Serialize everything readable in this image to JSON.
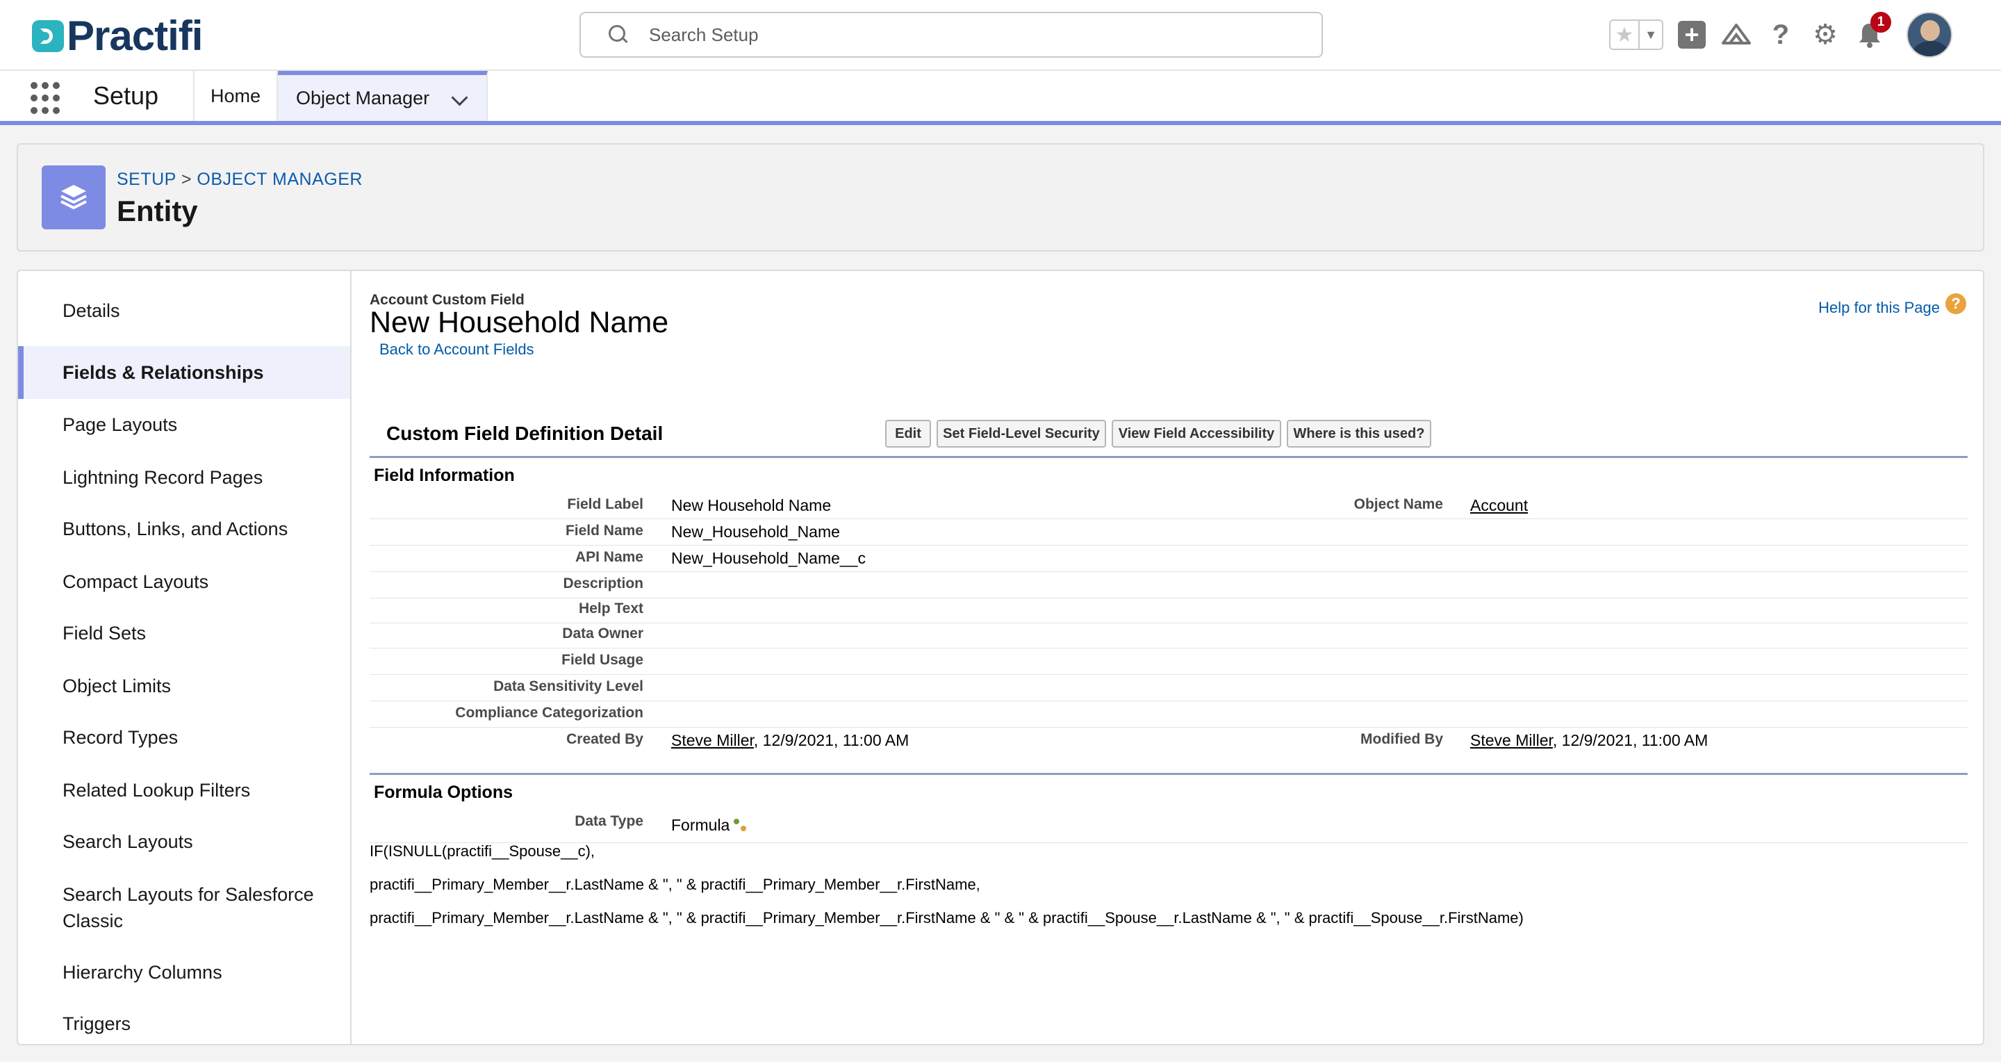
{
  "header": {
    "logo_text": "Practifi",
    "search_placeholder": "Search Setup",
    "notification_count": "1"
  },
  "nav": {
    "app_name": "Setup",
    "tabs": [
      {
        "label": "Home"
      },
      {
        "label": "Object Manager"
      }
    ]
  },
  "title_card": {
    "breadcrumb_setup": "SETUP",
    "breadcrumb_sep": ">",
    "breadcrumb_object_manager": "OBJECT MANAGER",
    "title": "Entity"
  },
  "sidebar": {
    "items": [
      {
        "label": "Details"
      },
      {
        "label": "Fields & Relationships"
      },
      {
        "label": "Page Layouts"
      },
      {
        "label": "Lightning Record Pages"
      },
      {
        "label": "Buttons, Links, and Actions"
      },
      {
        "label": "Compact Layouts"
      },
      {
        "label": "Field Sets"
      },
      {
        "label": "Object Limits"
      },
      {
        "label": "Record Types"
      },
      {
        "label": "Related Lookup Filters"
      },
      {
        "label": "Search Layouts"
      },
      {
        "label": "Search Layouts for Salesforce Classic"
      },
      {
        "label": "Hierarchy Columns"
      },
      {
        "label": "Triggers"
      }
    ]
  },
  "detail": {
    "sub_title": "Account Custom Field",
    "title": "New Household Name",
    "back_link": "Back to Account Fields",
    "help_link": "Help for this Page",
    "section_title": "Custom Field Definition Detail",
    "buttons": {
      "edit": "Edit",
      "fls": "Set Field-Level Security",
      "accessibility": "View Field Accessibility",
      "where_used": "Where is this used?"
    },
    "field_info_title": "Field Information",
    "fields": {
      "field_label": {
        "label": "Field Label",
        "value": "New Household Name"
      },
      "object_name": {
        "label": "Object Name",
        "value": "Account"
      },
      "field_name": {
        "label": "Field Name",
        "value": "New_Household_Name"
      },
      "api_name": {
        "label": "API Name",
        "value": "New_Household_Name__c"
      },
      "description": {
        "label": "Description",
        "value": ""
      },
      "help_text": {
        "label": "Help Text",
        "value": ""
      },
      "data_owner": {
        "label": "Data Owner",
        "value": ""
      },
      "field_usage": {
        "label": "Field Usage",
        "value": ""
      },
      "data_sensitivity": {
        "label": "Data Sensitivity Level",
        "value": ""
      },
      "compliance": {
        "label": "Compliance Categorization",
        "value": ""
      },
      "created_by": {
        "label": "Created By",
        "user": "Steve Miller",
        "date": ", 12/9/2021, 11:00 AM"
      },
      "modified_by": {
        "label": "Modified By",
        "user": "Steve Miller",
        "date": ", 12/9/2021, 11:00 AM"
      }
    },
    "formula_options_title": "Formula Options",
    "data_type": {
      "label": "Data Type",
      "value": "Formula"
    },
    "formula_lines": [
      "IF(ISNULL(practifi__Spouse__c),",
      "practifi__Primary_Member__r.LastName & \", \" & practifi__Primary_Member__r.FirstName,",
      "practifi__Primary_Member__r.LastName & \", \" & practifi__Primary_Member__r.FirstName & \" & \" & practifi__Spouse__r.LastName & \", \" & practifi__Spouse__r.FirstName)"
    ]
  },
  "colors": {
    "brand_accent": "#7e8be4",
    "link": "#015ba7",
    "logo_dark": "#17375e",
    "logo_teal": "#2bb3c0",
    "badge_red": "#ba0517"
  }
}
